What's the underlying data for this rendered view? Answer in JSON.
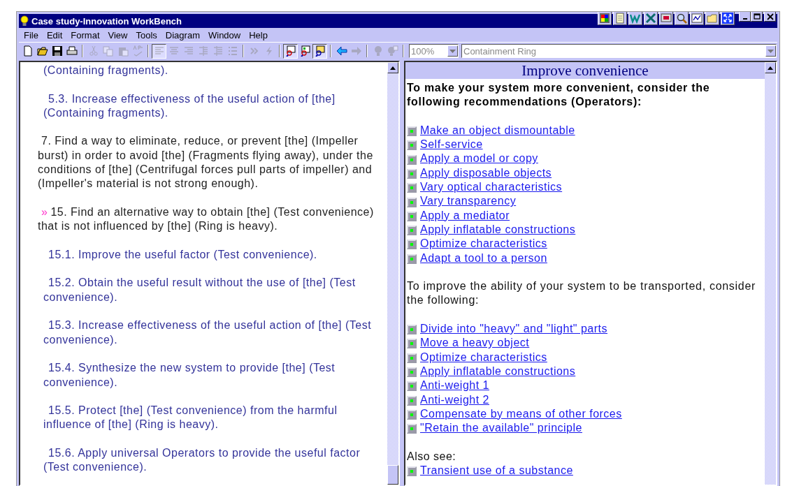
{
  "window": {
    "title": "Case study-Innovation WorkBench",
    "title_tools": [
      {
        "kind": "palette"
      },
      {
        "kind": "notepad"
      },
      {
        "kind": "word"
      },
      {
        "kind": "excel"
      },
      {
        "kind": "screen"
      },
      {
        "kind": "find"
      },
      {
        "kind": "chart"
      },
      {
        "kind": "folder"
      },
      {
        "kind": "fit"
      }
    ]
  },
  "menu": [
    {
      "label": "File"
    },
    {
      "label": "Edit"
    },
    {
      "label": "Format"
    },
    {
      "label": "View"
    },
    {
      "label": "Tools"
    },
    {
      "label": "Diagram"
    },
    {
      "label": "Window"
    },
    {
      "label": "Help"
    }
  ],
  "toolbar": {
    "groups": [
      [
        {
          "kind": "new",
          "disabled": false,
          "pressed": false
        },
        {
          "kind": "open",
          "disabled": false,
          "pressed": false
        },
        {
          "kind": "save",
          "disabled": false,
          "pressed": false
        },
        {
          "kind": "print",
          "disabled": false,
          "pressed": false
        }
      ],
      [
        {
          "kind": "cut",
          "disabled": true,
          "pressed": false
        },
        {
          "kind": "copy",
          "disabled": true,
          "pressed": false
        },
        {
          "kind": "paste",
          "disabled": true,
          "pressed": false
        },
        {
          "kind": "spell",
          "disabled": true,
          "pressed": false
        }
      ],
      [
        {
          "kind": "align-left",
          "disabled": true,
          "pressed": true
        },
        {
          "kind": "align-center",
          "disabled": true,
          "pressed": false
        },
        {
          "kind": "align-right",
          "disabled": true,
          "pressed": false
        },
        {
          "kind": "outdent",
          "disabled": true,
          "pressed": false
        },
        {
          "kind": "indent",
          "disabled": true,
          "pressed": false
        },
        {
          "kind": "bullets",
          "disabled": true,
          "pressed": false
        }
      ],
      [
        {
          "kind": "chevrons",
          "disabled": true,
          "pressed": false
        },
        {
          "kind": "bolt",
          "disabled": true,
          "pressed": false
        }
      ],
      [
        {
          "kind": "view-doc",
          "disabled": false,
          "pressed": true
        },
        {
          "kind": "view-diagram",
          "disabled": false,
          "pressed": false
        },
        {
          "kind": "view-card",
          "disabled": false,
          "pressed": true
        }
      ],
      [
        {
          "kind": "back",
          "disabled": false,
          "pressed": false
        },
        {
          "kind": "forward",
          "disabled": true,
          "pressed": false
        }
      ],
      [
        {
          "kind": "bulb",
          "disabled": true,
          "pressed": false
        },
        {
          "kind": "bulb-grid",
          "disabled": true,
          "pressed": false
        }
      ]
    ],
    "zoom": {
      "value": "100%",
      "disabled": true
    },
    "context": {
      "value": "Containment Ring",
      "disabled": true
    }
  },
  "left_pane": {
    "items": [
      {
        "kind": "tail",
        "text": "(Containing fragments)."
      },
      {
        "kind": "sub",
        "text": "5.3. Increase effectiveness of the useful action of [the] (Containing fragments)."
      },
      {
        "kind": "main",
        "text": "7. Find a way to eliminate, reduce, or prevent [the] (Impeller burst) in order to avoid [the] (Fragments flying away), under the conditions of [the] (Centrifugal forces pull parts of impeller) and (Impeller's material is not strong enough)."
      },
      {
        "kind": "main",
        "marker": "»",
        "text": "15. Find an alternative way to obtain [the] (Test convenience) that is not influenced by [the] (Ring is heavy)."
      },
      {
        "kind": "sub",
        "text": "15.1. Improve the useful factor (Test convenience)."
      },
      {
        "kind": "sub",
        "text": "15.2. Obtain the useful result without the use of [the] (Test convenience)."
      },
      {
        "kind": "sub",
        "text": "15.3. Increase effectiveness of the useful action of [the] (Test convenience)."
      },
      {
        "kind": "sub",
        "text": "15.4. Synthesize the new system to provide [the] (Test convenience)."
      },
      {
        "kind": "sub",
        "text": "15.5. Protect [the] (Test convenience) from the harmful influence of [the] (Ring is heavy)."
      },
      {
        "kind": "sub",
        "text": "15.6. Apply universal Operators to provide the useful factor (Test convenience)."
      }
    ]
  },
  "right_pane": {
    "heading": "Improve convenience",
    "blocks": [
      {
        "kind": "text",
        "bold": true,
        "text": "To make your system more convenient, consider the following recommendations (Operators):"
      },
      {
        "kind": "links",
        "items": [
          "Make an object dismountable",
          "Self-service",
          "Apply a model or copy",
          "Apply disposable objects",
          "Vary optical characteristics",
          "Vary transparency",
          "Apply a mediator",
          "Apply inflatable constructions",
          "Optimize characteristics",
          "Adapt a tool to a person"
        ]
      },
      {
        "kind": "text",
        "bold": false,
        "text": "To improve the ability of your system to be transported, consider the following:"
      },
      {
        "kind": "links",
        "items": [
          "Divide into \"heavy\" and \"light\" parts",
          "Move a heavy object",
          "Optimize characteristics",
          "Apply inflatable constructions",
          "Anti-weight 1",
          "Anti-weight 2",
          "Compensate by means of other forces",
          "\"Retain the available\" principle"
        ]
      },
      {
        "kind": "caption",
        "text": "Also see:"
      },
      {
        "kind": "links",
        "items": [
          "Transient use of a substance"
        ]
      }
    ]
  }
}
